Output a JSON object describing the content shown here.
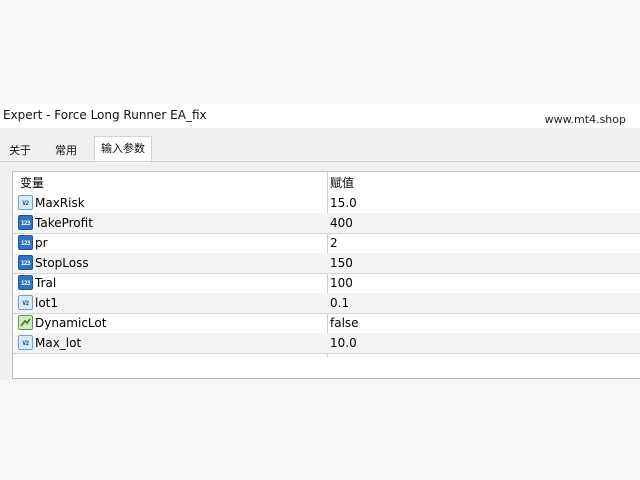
{
  "window": {
    "title": "Expert - Force Long Runner EA_fix",
    "watermark": "www.mt4.shop"
  },
  "tabs": [
    {
      "label": "关于"
    },
    {
      "label": "常用"
    },
    {
      "label": "输入参数"
    }
  ],
  "table": {
    "headers": {
      "name": "变量",
      "value": "赋值"
    },
    "rows": [
      {
        "name": "MaxRisk",
        "value": "15.0",
        "type_icon": "double-type-icon"
      },
      {
        "name": "TakeProfit",
        "value": "400",
        "type_icon": "integer-type-icon"
      },
      {
        "name": "pr",
        "value": "2",
        "type_icon": "integer-type-icon"
      },
      {
        "name": "StopLoss",
        "value": "150",
        "type_icon": "integer-type-icon"
      },
      {
        "name": "Tral",
        "value": "100",
        "type_icon": "integer-type-icon"
      },
      {
        "name": "lot1",
        "value": "0.1",
        "type_icon": "double-type-icon"
      },
      {
        "name": "DynamicLot",
        "value": "false",
        "type_icon": "boolean-type-icon"
      },
      {
        "name": "Max_lot",
        "value": "10.0",
        "type_icon": "double-type-icon"
      }
    ]
  },
  "colors": {
    "page_background": "#f7f7f9",
    "panel_background": "#f0f0f0",
    "row_alt": "#f4f4f4",
    "double_icon": "#d6ecf8",
    "integer_icon": "#2f74c0",
    "boolean_icon": "#cfeac4"
  }
}
